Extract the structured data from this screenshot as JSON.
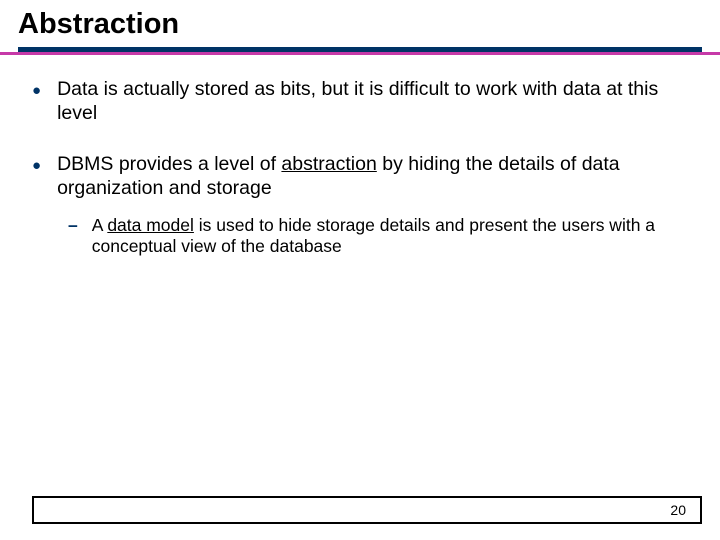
{
  "slide": {
    "title": "Abstraction",
    "bullets": [
      {
        "text_1": "Data is actually stored as bits, but it is difficult to work with data at this level"
      },
      {
        "text_1": "DBMS provides a level of ",
        "underline_1": "abstraction",
        "text_2": " by hiding the details of data organization and storage",
        "sub": {
          "text_1": "A ",
          "underline_1": "data model",
          "text_2": " is used to hide storage details and present the users with a conceptual view of the database"
        }
      }
    ],
    "page_number": "20"
  }
}
